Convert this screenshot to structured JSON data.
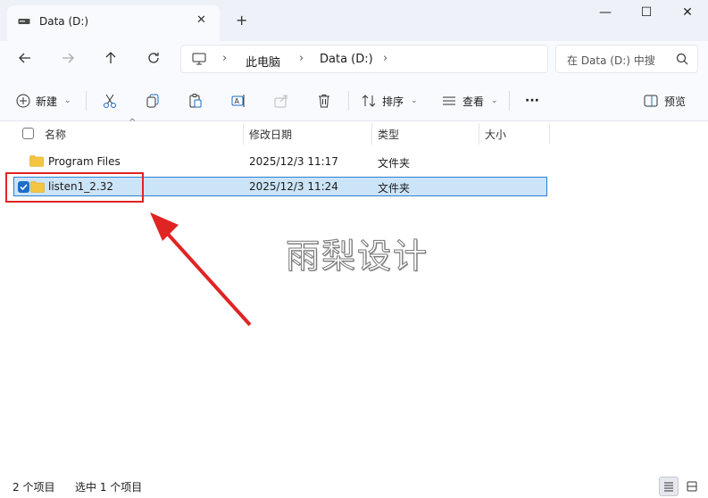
{
  "tab": {
    "title": "Data (D:)",
    "close": "✕",
    "new": "+"
  },
  "window": {
    "minimize": "—",
    "maximize": "☐",
    "close": "✕"
  },
  "nav": {
    "breadcrumbs": [
      "此电脑",
      "Data (D:)"
    ],
    "separator": "›",
    "search_placeholder": "在 Data (D:) 中搜"
  },
  "commands": {
    "new_label": "新建",
    "sort_label": "排序",
    "view_label": "查看",
    "more_label": "···",
    "preview_label": "预览"
  },
  "columns": [
    "名称",
    "修改日期",
    "类型",
    "大小"
  ],
  "rows": [
    {
      "name": "Program Files",
      "modified": "2025/12/3 11:17",
      "type": "文件夹",
      "size": "",
      "selected": false
    },
    {
      "name": "listen1_2.32",
      "modified": "2025/12/3 11:24",
      "type": "文件夹",
      "size": "",
      "selected": true
    }
  ],
  "watermark": "雨梨设计",
  "status": {
    "item_count": "2 个项目",
    "selection": "选中 1 个项目"
  },
  "colors": {
    "accent": "#1c6fc4",
    "selection_bg": "#cce4f7",
    "annotation_red": "#e02424",
    "folder_yellow": "#f4c542"
  }
}
